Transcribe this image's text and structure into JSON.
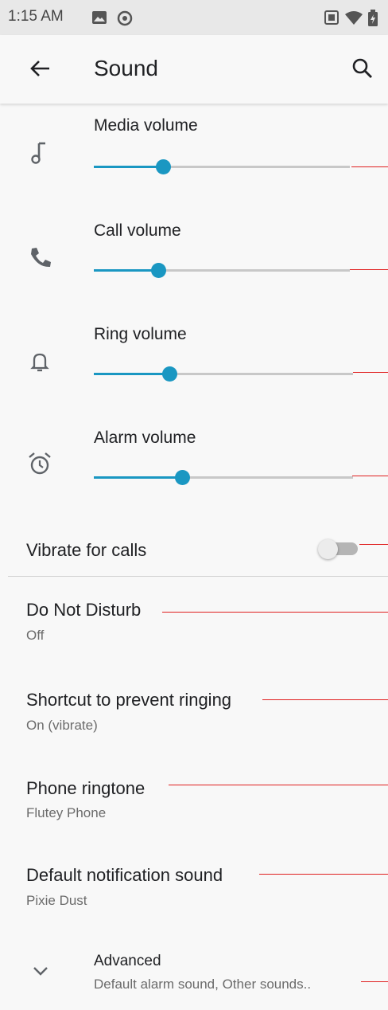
{
  "status_bar": {
    "time": "1:15 AM"
  },
  "app_bar": {
    "title": "Sound"
  },
  "volumes": [
    {
      "label": "Media volume",
      "level": 0.27,
      "icon": "music-note-icon"
    },
    {
      "label": "Call volume",
      "level": 0.25,
      "icon": "phone-icon"
    },
    {
      "label": "Ring volume",
      "level": 0.29,
      "icon": "bell-icon"
    },
    {
      "label": "Alarm volume",
      "level": 0.34,
      "icon": "alarm-clock-icon"
    }
  ],
  "vibrate": {
    "label": "Vibrate for calls",
    "on": false
  },
  "items": [
    {
      "title": "Do Not Disturb",
      "subtitle": "Off"
    },
    {
      "title": "Shortcut to prevent ringing",
      "subtitle": "On (vibrate)"
    },
    {
      "title": "Phone ringtone",
      "subtitle": "Flutey Phone"
    },
    {
      "title": "Default notification sound",
      "subtitle": "Pixie Dust"
    }
  ],
  "advanced": {
    "title": "Advanced",
    "subtitle": "Default alarm sound, Other sounds.."
  },
  "colors": {
    "accent": "#1a97c2",
    "annotation_line": "#e02020",
    "status_bar": "#e8e8e8",
    "background": "#f8f8f8"
  }
}
